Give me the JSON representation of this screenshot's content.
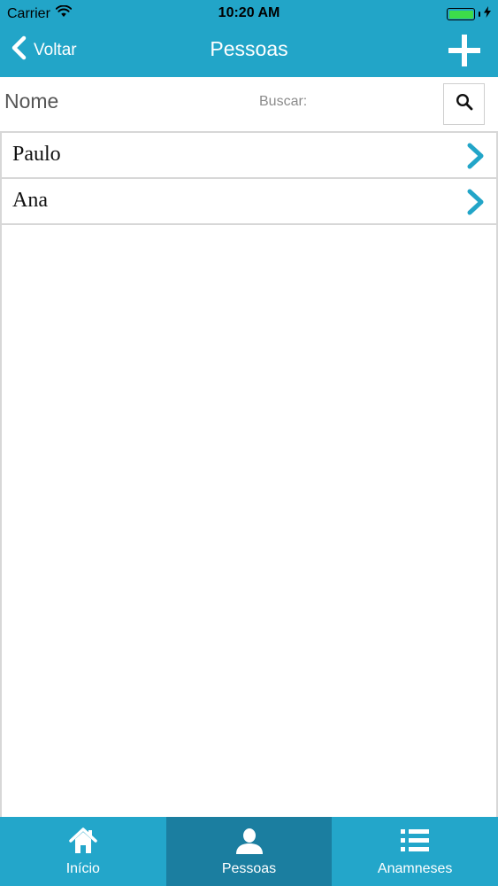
{
  "status_bar": {
    "carrier": "Carrier",
    "time": "10:20 AM",
    "battery_level": 1.0,
    "wifi_icon": "wifi-icon",
    "charging_icon": "bolt-icon"
  },
  "nav": {
    "back_label": "Voltar",
    "title": "Pessoas",
    "add_icon": "plus-icon"
  },
  "search": {
    "label": "Nome",
    "caption": "Buscar:",
    "icon": "search-icon"
  },
  "list": {
    "items": [
      {
        "label": "Paulo"
      },
      {
        "label": "Ana"
      }
    ]
  },
  "tab_bar": {
    "tabs": [
      {
        "label": "Início",
        "icon": "home-icon",
        "active": false
      },
      {
        "label": "Pessoas",
        "icon": "person-icon",
        "active": true
      },
      {
        "label": "Anamneses",
        "icon": "list-icon",
        "active": false
      }
    ]
  },
  "colors": {
    "brand": "#22a5c8",
    "tab_active": "#1b7ea0",
    "chevron": "#22a5c8",
    "divider": "#d7d7d7"
  }
}
